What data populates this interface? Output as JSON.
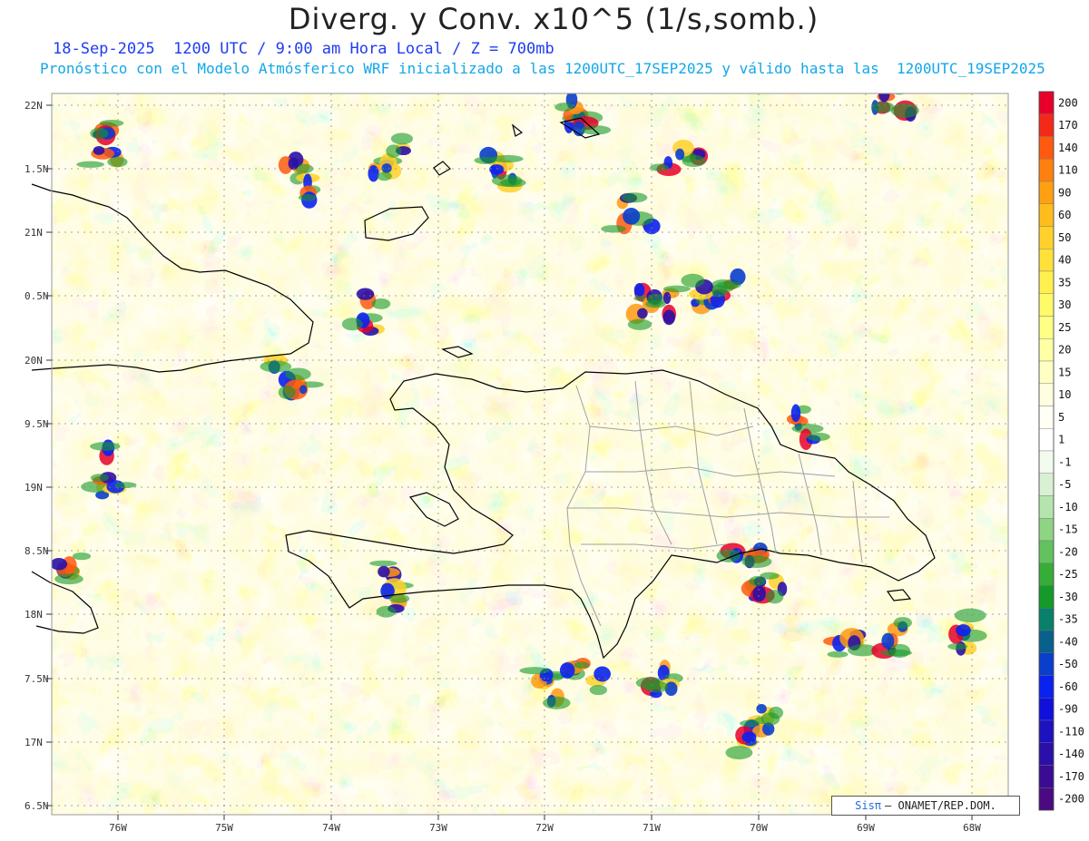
{
  "header": {
    "title": "Diverg. y Conv. x10^5 (1/s,somb.)",
    "subtitle_line1": "18-Sep-2025  1200 UTC / 9:00 am Hora Local / Z = 700mb",
    "subtitle_line2": "Pronóstico con el Modelo Atmósferico WRF inicializado a las 1200UTC_17SEP2025 y válido hasta las  1200UTC_19SEP2025"
  },
  "map": {
    "lat_labels": [
      "22N",
      "1.5N",
      "21N",
      "0.5N",
      "20N",
      "9.5N",
      "19N",
      "8.5N",
      "18N",
      "7.5N",
      "17N",
      "6.5N"
    ],
    "lon_labels": [
      "76W",
      "75W",
      "74W",
      "73W",
      "72W",
      "71W",
      "70W",
      "69W",
      "68W"
    ]
  },
  "colorbar": {
    "labels": [
      "200",
      "170",
      "140",
      "110",
      "90",
      "60",
      "50",
      "40",
      "35",
      "30",
      "25",
      "20",
      "15",
      "10",
      "5",
      "1",
      "-1",
      "-5",
      "-10",
      "-15",
      "-20",
      "-25",
      "-30",
      "-35",
      "-40",
      "-50",
      "-60",
      "-90",
      "-110",
      "-140",
      "-170",
      "-200"
    ],
    "colors": [
      "#e8002a",
      "#f32a1a",
      "#ff5a10",
      "#ff8010",
      "#ffa012",
      "#ffbd1c",
      "#ffd12a",
      "#ffe13a",
      "#fff050",
      "#fffa6a",
      "#ffff84",
      "#ffffa6",
      "#ffffc4",
      "#fffee0",
      "#fffff4",
      "#ffffff",
      "#f3fbee",
      "#d8f1d2",
      "#b6e4ae",
      "#8ed484",
      "#62c25e",
      "#36ad38",
      "#159a2a",
      "#08806a",
      "#08608c",
      "#0a3ecc",
      "#0a22f0",
      "#1010dc",
      "#1c12c0",
      "#2a10a8",
      "#3a0c94",
      "#4a0a82"
    ]
  },
  "credit": {
    "sis": "Sisπ",
    "text": "– ONAMET/REP.DOM."
  }
}
